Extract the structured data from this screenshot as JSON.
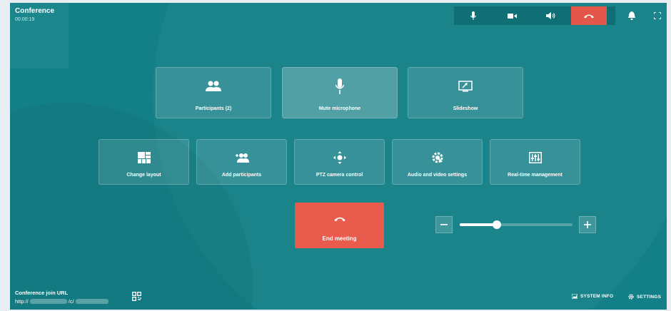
{
  "header": {
    "title": "Conference",
    "timer": "00:00:19"
  },
  "main_actions": [
    {
      "label": "Participants (2)",
      "icon": "participants-icon"
    },
    {
      "label": "Mute microphone",
      "icon": "microphone-icon"
    },
    {
      "label": "Slideshow",
      "icon": "slideshow-icon"
    }
  ],
  "secondary_actions": [
    {
      "label": "Change layout",
      "icon": "layout-icon"
    },
    {
      "label": "Add participants",
      "icon": "add-participants-icon"
    },
    {
      "label": "PTZ camera control",
      "icon": "ptz-icon"
    },
    {
      "label": "Audio and video settings",
      "icon": "av-settings-icon"
    },
    {
      "label": "Real-time management",
      "icon": "management-icon"
    }
  ],
  "end_meeting": {
    "label": "End meeting"
  },
  "volume": {
    "level": 0.33
  },
  "join": {
    "label": "Conference join URL",
    "url_prefix": "http://",
    "url_mid": "/c/"
  },
  "footer": {
    "system_info": "SYSTEM INFO",
    "settings": "SETTINGS"
  },
  "colors": {
    "background": "#137f86",
    "hangup": "#e2574a",
    "end_meeting": "#e85b4d"
  }
}
